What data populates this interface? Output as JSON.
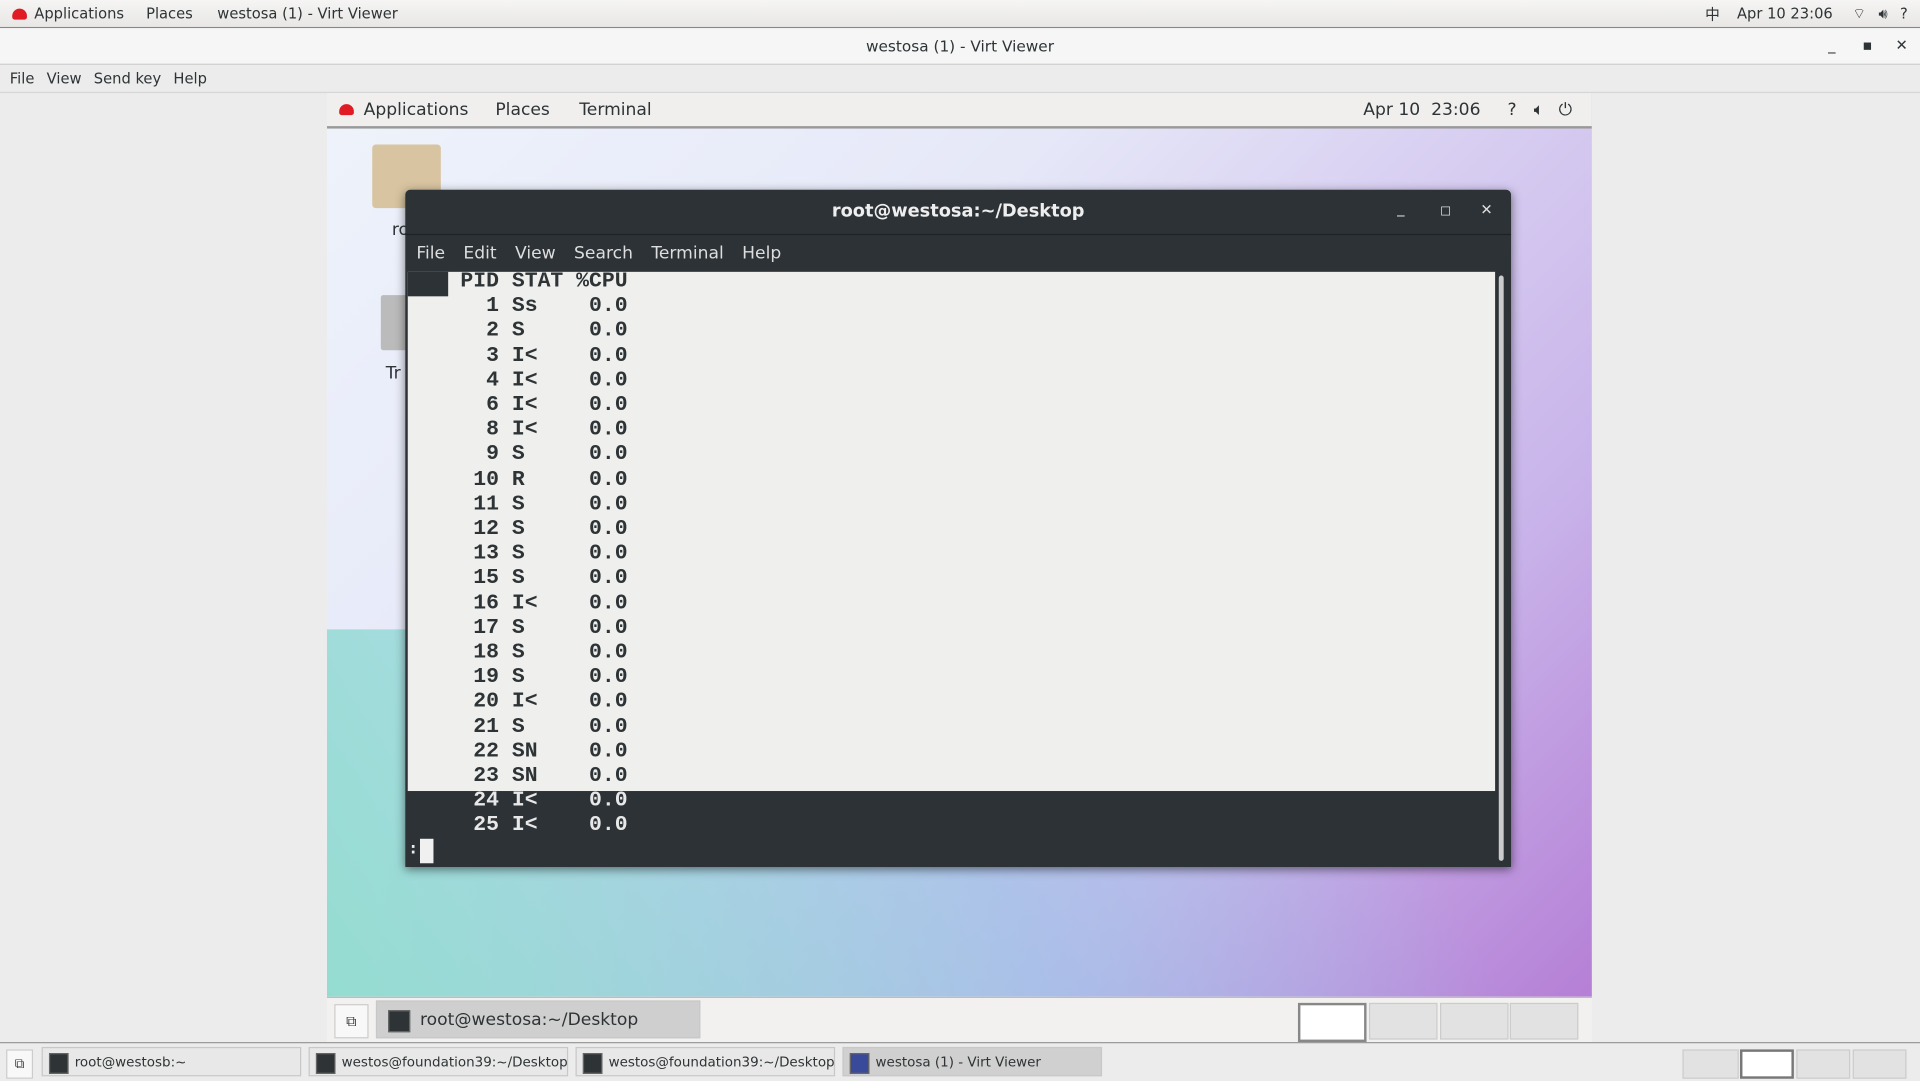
{
  "host_topbar": {
    "applications": "Applications",
    "places": "Places",
    "window": "westosa (1) - Virt Viewer",
    "input_method": "中",
    "clock": "Apr 10 23:06"
  },
  "viewer": {
    "title": "westosa (1) - Virt Viewer",
    "menu": [
      "File",
      "View",
      "Send key",
      "Help"
    ]
  },
  "guest_topbar": {
    "applications": "Applications",
    "places": "Places",
    "terminal": "Terminal",
    "clock": "Apr 10  23:06"
  },
  "desktop_icons": [
    {
      "label": "ro"
    },
    {
      "label": "Tr"
    }
  ],
  "terminal": {
    "title": "root@westosa:~/Desktop",
    "menu": [
      "File",
      "Edit",
      "View",
      "Search",
      "Terminal",
      "Help"
    ],
    "header": "PID STAT %CPU",
    "rows": [
      [
        "1",
        "Ss",
        "0.0"
      ],
      [
        "2",
        "S",
        "0.0"
      ],
      [
        "3",
        "I<",
        "0.0"
      ],
      [
        "4",
        "I<",
        "0.0"
      ],
      [
        "6",
        "I<",
        "0.0"
      ],
      [
        "8",
        "I<",
        "0.0"
      ],
      [
        "9",
        "S",
        "0.0"
      ],
      [
        "10",
        "R",
        "0.0"
      ],
      [
        "11",
        "S",
        "0.0"
      ],
      [
        "12",
        "S",
        "0.0"
      ],
      [
        "13",
        "S",
        "0.0"
      ],
      [
        "15",
        "S",
        "0.0"
      ],
      [
        "16",
        "I<",
        "0.0"
      ],
      [
        "17",
        "S",
        "0.0"
      ],
      [
        "18",
        "S",
        "0.0"
      ],
      [
        "19",
        "S",
        "0.0"
      ],
      [
        "20",
        "I<",
        "0.0"
      ],
      [
        "21",
        "S",
        "0.0"
      ],
      [
        "22",
        "SN",
        "0.0"
      ],
      [
        "23",
        "SN",
        "0.0"
      ],
      [
        "24",
        "I<",
        "0.0"
      ],
      [
        "25",
        "I<",
        "0.0"
      ]
    ],
    "prompt": ":"
  },
  "guest_taskbar": {
    "item": "root@westosa:~/Desktop"
  },
  "host_taskbar": {
    "items": [
      "root@westosb:~",
      "westos@foundation39:~/Desktop",
      "westos@foundation39:~/Desktop",
      "westosa (1) - Virt Viewer"
    ]
  }
}
